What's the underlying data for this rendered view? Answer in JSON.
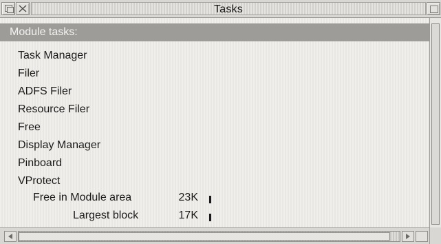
{
  "window": {
    "title": "Tasks"
  },
  "section": {
    "heading": "Module tasks:"
  },
  "tasks": [
    "Task Manager",
    "Filer",
    "ADFS Filer",
    "Resource Filer",
    "Free",
    "Display Manager",
    "Pinboard",
    "VProtect"
  ],
  "memory": {
    "free_label": "Free in Module area",
    "free_value": "23K",
    "largest_label": "Largest block",
    "largest_value": "17K"
  },
  "icons": {
    "back": "back-icon",
    "close": "close-icon",
    "toggle": "toggle-size-icon",
    "scroll_left": "scroll-left-arrow-icon",
    "scroll_right": "scroll-right-arrow-icon"
  },
  "colors": {
    "heading_bg": "#9e9c99",
    "heading_text": "#f4f3f1",
    "window_bg": "#e9e7e4"
  }
}
